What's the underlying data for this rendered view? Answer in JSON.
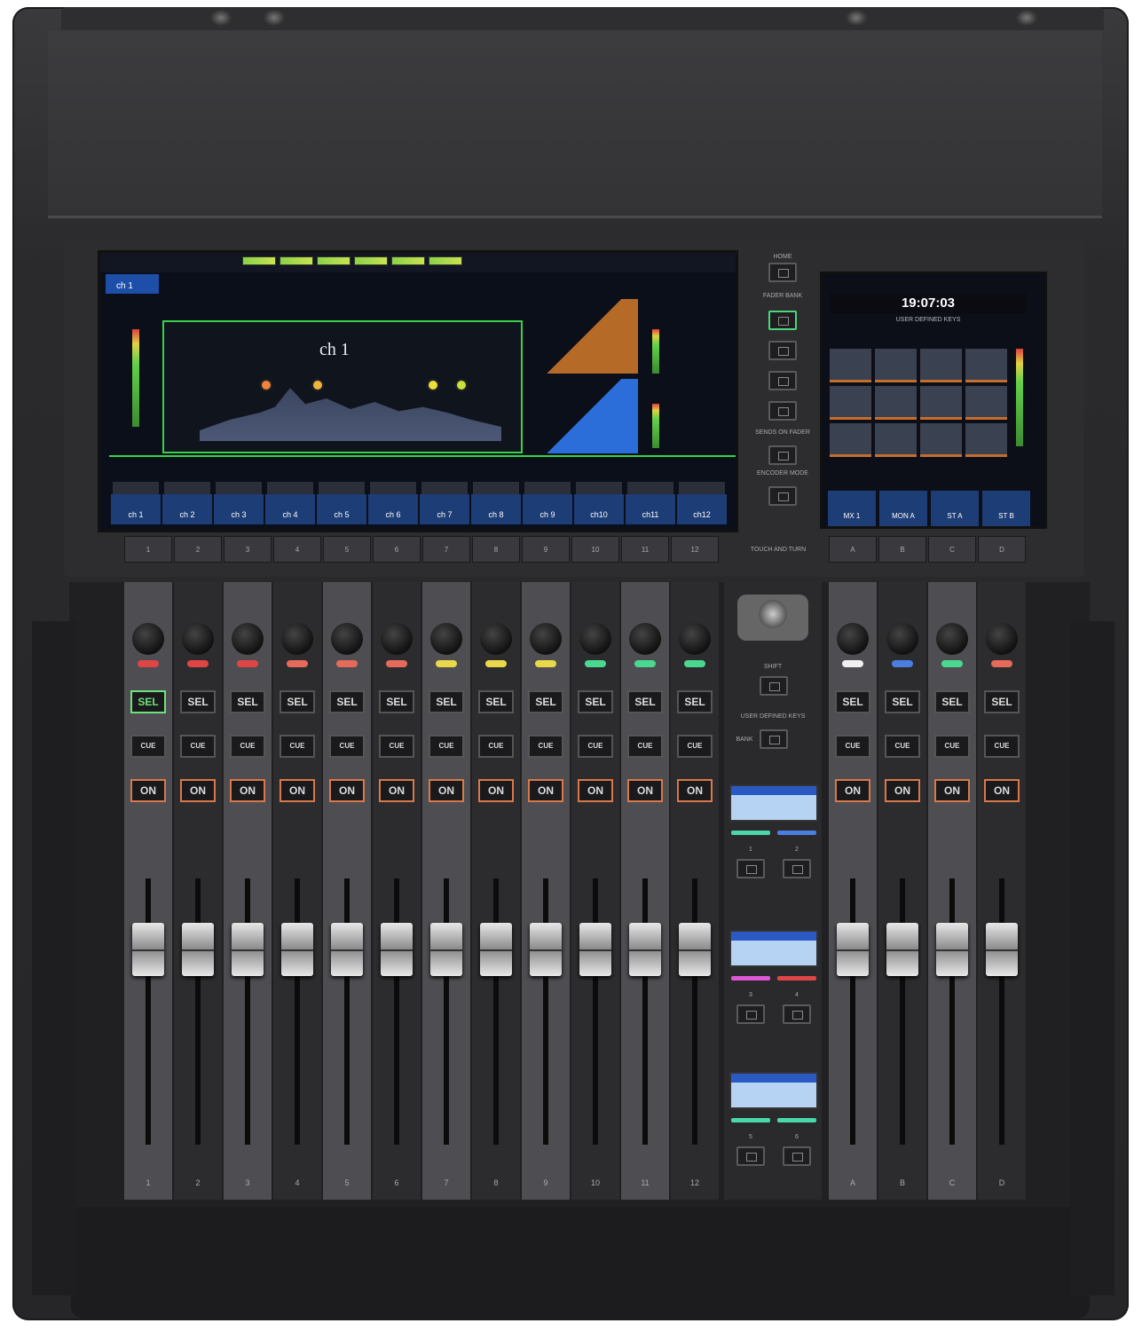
{
  "main_screen": {
    "channel_title": "ch 1",
    "selected_channel": "ch 1",
    "strip_names": [
      "ch 1",
      "ch 2",
      "ch 3",
      "ch 4",
      "ch 5",
      "ch 6",
      "ch 7",
      "ch 8",
      "ch 9",
      "ch10",
      "ch11",
      "ch12"
    ]
  },
  "side_screen": {
    "clock": "19:07:03",
    "user_defined_keys_title": "USER DEFINED KEYS",
    "bottom_slots": [
      "MX 1",
      "MON A",
      "ST A",
      "ST B"
    ]
  },
  "center_controls": {
    "home": "HOME",
    "fader_bank": "FADER BANK",
    "sends_on_fader": "SENDS ON FADER",
    "encoder_mode": "ENCODER MODE",
    "touch_and_turn": "TOUCH AND TURN",
    "shift": "SHIFT",
    "user_defined_keys": "USER DEFINED KEYS",
    "bank": "BANK",
    "key_numbers": [
      "1",
      "2",
      "3",
      "4",
      "5",
      "6"
    ]
  },
  "channels": [
    {
      "num": "1",
      "sel": "SEL",
      "cue": "CUE",
      "on": "ON",
      "color": "#e04545"
    },
    {
      "num": "2",
      "sel": "SEL",
      "cue": "CUE",
      "on": "ON",
      "color": "#e04545"
    },
    {
      "num": "3",
      "sel": "SEL",
      "cue": "CUE",
      "on": "ON",
      "color": "#e04545"
    },
    {
      "num": "4",
      "sel": "SEL",
      "cue": "CUE",
      "on": "ON",
      "color": "#e56a5a"
    },
    {
      "num": "5",
      "sel": "SEL",
      "cue": "CUE",
      "on": "ON",
      "color": "#e56a5a"
    },
    {
      "num": "6",
      "sel": "SEL",
      "cue": "CUE",
      "on": "ON",
      "color": "#e56a5a"
    },
    {
      "num": "7",
      "sel": "SEL",
      "cue": "CUE",
      "on": "ON",
      "color": "#e8d84a"
    },
    {
      "num": "8",
      "sel": "SEL",
      "cue": "CUE",
      "on": "ON",
      "color": "#e8d84a"
    },
    {
      "num": "9",
      "sel": "SEL",
      "cue": "CUE",
      "on": "ON",
      "color": "#e8d84a"
    },
    {
      "num": "10",
      "sel": "SEL",
      "cue": "CUE",
      "on": "ON",
      "color": "#4ad890"
    },
    {
      "num": "11",
      "sel": "SEL",
      "cue": "CUE",
      "on": "ON",
      "color": "#4ad890"
    },
    {
      "num": "12",
      "sel": "SEL",
      "cue": "CUE",
      "on": "ON",
      "color": "#4ad890"
    }
  ],
  "aux_channels": [
    {
      "num": "A",
      "sel": "SEL",
      "cue": "CUE",
      "on": "ON",
      "color": "#f0f0f0"
    },
    {
      "num": "B",
      "sel": "SEL",
      "cue": "CUE",
      "on": "ON",
      "color": "#4a7ee0"
    },
    {
      "num": "C",
      "sel": "SEL",
      "cue": "CUE",
      "on": "ON",
      "color": "#4ad890"
    },
    {
      "num": "D",
      "sel": "SEL",
      "cue": "CUE",
      "on": "ON",
      "color": "#e56a5a"
    }
  ]
}
